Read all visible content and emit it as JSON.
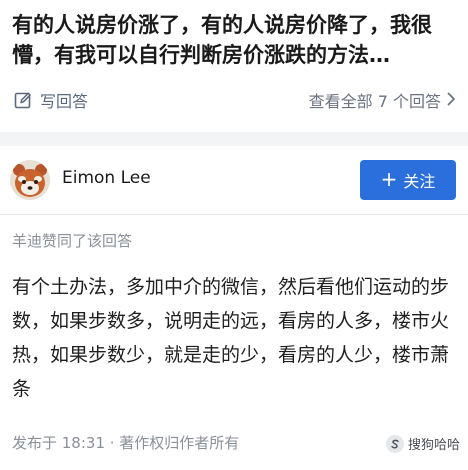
{
  "question": {
    "title": "有的人说房价涨了，有的人说房价降了，我很懵，有我可以自行判断房价涨跌的方法…",
    "write_answer_label": "写回答",
    "view_all_label": "查看全部 7 个回答",
    "write_icon": "edit-icon",
    "arrow_icon": "chevron-right-icon"
  },
  "answer": {
    "author": {
      "name": "Eimon Lee",
      "avatar_icon": "red-panda-avatar"
    },
    "follow": {
      "plus": "+",
      "label": "关注"
    },
    "upvote_note": "羊迪赞同了该回答",
    "body": "有个土办法，多加中介的微信，然后看他们运动的步数，如果步数多，说明走的远，看房的人多，楼市火热，如果步数少，就是走的少，看房的人少，楼市萧条",
    "footer": "发布于 18:31 · 著作权归作者所有"
  },
  "watermark": {
    "text": "搜狗哈哈",
    "icon": "sogou-logo-icon"
  },
  "colors": {
    "accent": "#2a6fdb",
    "muted_text": "#8a8f99",
    "gap_band": "#f3f4f6"
  }
}
